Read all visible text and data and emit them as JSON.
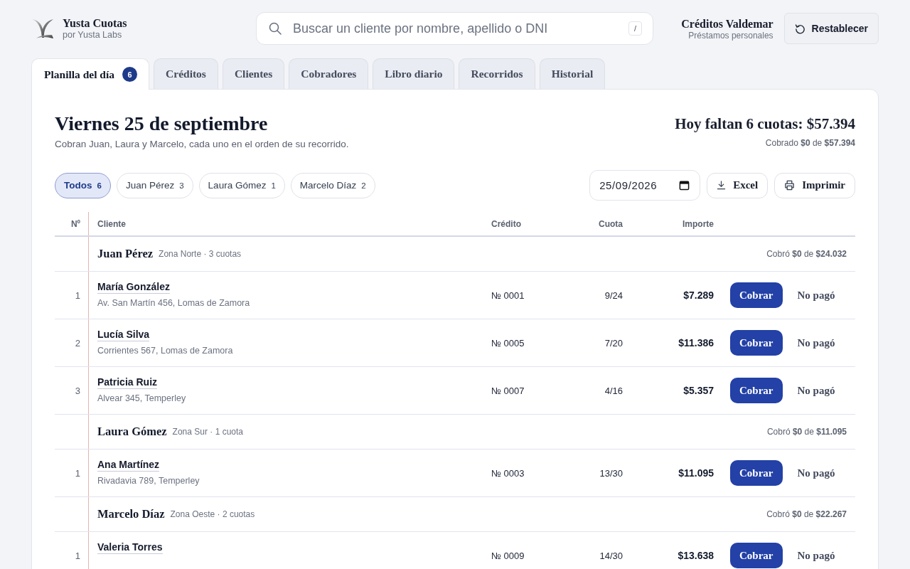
{
  "brand": {
    "name": "Yusta Cuotas",
    "byline": "por Yusta Labs"
  },
  "search": {
    "placeholder": "Buscar un cliente por nombre, apellido o DNI",
    "shortcut": "/"
  },
  "account": {
    "name": "Créditos Valdemar",
    "subtitle": "Préstamos personales"
  },
  "reset_button": {
    "label": "Restablecer"
  },
  "tabs": [
    {
      "label": "Planilla del día",
      "badge": "6",
      "selected": true
    },
    {
      "label": "Créditos",
      "selected": false
    },
    {
      "label": "Clientes",
      "selected": false
    },
    {
      "label": "Cobradores",
      "selected": false
    },
    {
      "label": "Libro diario",
      "selected": false
    },
    {
      "label": "Recorridos",
      "selected": false
    },
    {
      "label": "Historial",
      "selected": false
    }
  ],
  "day": {
    "title": "Viernes 25 de septiembre",
    "subtitle": "Cobran Juan, Laura y Marcelo, cada uno en el orden de su recorrido.",
    "summary": "Hoy faltan 6 cuotas: **$57.394**",
    "collected": "Cobrado **$0** de **$57.394**"
  },
  "filters": [
    {
      "label": "Todos",
      "count": "6",
      "selected": true
    },
    {
      "label": "Juan Pérez",
      "count": "3",
      "selected": false
    },
    {
      "label": "Laura Gómez",
      "count": "1",
      "selected": false
    },
    {
      "label": "Marcelo Díaz",
      "count": "2",
      "selected": false
    }
  ],
  "date_field": {
    "value": "25/09/2026"
  },
  "actions": [
    {
      "label": "Excel",
      "kind": "download"
    },
    {
      "label": "Imprimir",
      "kind": "print"
    }
  ],
  "table": {
    "columns": [
      "Nº",
      "Cliente",
      "Crédito",
      "Cuota",
      "Importe"
    ],
    "groups": [
      {
        "collector": "Juan Pérez",
        "details": "Zona Norte · 3 cuotas",
        "collected": "Cobró **$0** de **$24.032**",
        "rows": [
          {
            "number": "1",
            "client": "María González",
            "address": "Av. San Martín 456, Lomas de Zamora",
            "credit": "№ 0001",
            "installment": "9/24",
            "amount": "$7.289",
            "pay_label": "Cobrar",
            "skip_label": "No pagó"
          },
          {
            "number": "2",
            "client": "Lucía Silva",
            "address": "Corrientes 567, Lomas de Zamora",
            "credit": "№ 0005",
            "installment": "7/20",
            "amount": "$11.386",
            "pay_label": "Cobrar",
            "skip_label": "No pagó"
          },
          {
            "number": "3",
            "client": "Patricia Ruiz",
            "address": "Alvear 345, Temperley",
            "credit": "№ 0007",
            "installment": "4/16",
            "amount": "$5.357",
            "pay_label": "Cobrar",
            "skip_label": "No pagó"
          }
        ]
      },
      {
        "collector": "Laura Gómez",
        "details": "Zona Sur · 1 cuota",
        "collected": "Cobró **$0** de **$11.095**",
        "rows": [
          {
            "number": "1",
            "client": "Ana Martínez",
            "address": "Rivadavia 789, Temperley",
            "credit": "№ 0003",
            "installment": "13/30",
            "amount": "$11.095",
            "pay_label": "Cobrar",
            "skip_label": "No pagó"
          }
        ]
      },
      {
        "collector": "Marcelo Díaz",
        "details": "Zona Oeste · 2 cuotas",
        "collected": "Cobró **$0** de **$22.267**",
        "rows": [
          {
            "number": "1",
            "client": "Valeria Torres",
            "credit": "№ 0009",
            "installment": "14/30",
            "amount": "$13.638",
            "pay_label": "Cobrar",
            "skip_label": "No pagó"
          }
        ]
      }
    ]
  }
}
